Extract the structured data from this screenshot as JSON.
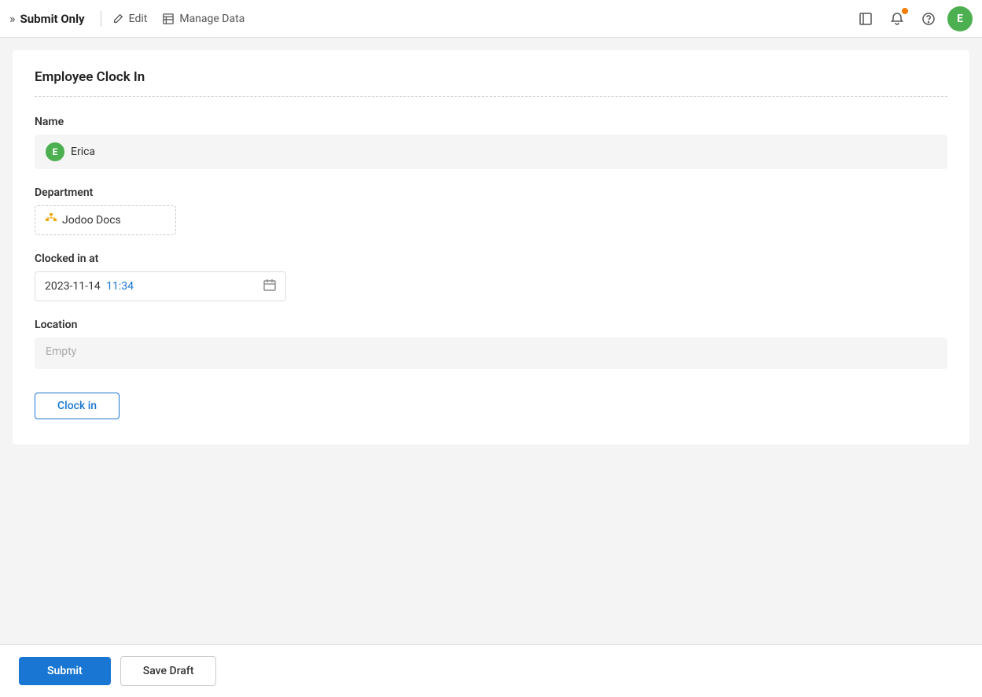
{
  "topbar": {
    "mode_label": "Submit Only",
    "edit_label": "Edit",
    "manage_data_label": "Manage Data",
    "avatar_letter": "E"
  },
  "form": {
    "section_title": "Employee Clock In",
    "name_label": "Name",
    "name_value": "Erica",
    "name_avatar_letter": "E",
    "department_label": "Department",
    "department_value": "Jodoo Docs",
    "clocked_in_at_label": "Clocked in at",
    "clocked_in_date": "2023-11-14",
    "clocked_in_time": "11:34",
    "location_label": "Location",
    "location_placeholder": "Empty",
    "clock_in_button_label": "Clock in"
  },
  "bottom": {
    "submit_label": "Submit",
    "save_draft_label": "Save Draft"
  }
}
